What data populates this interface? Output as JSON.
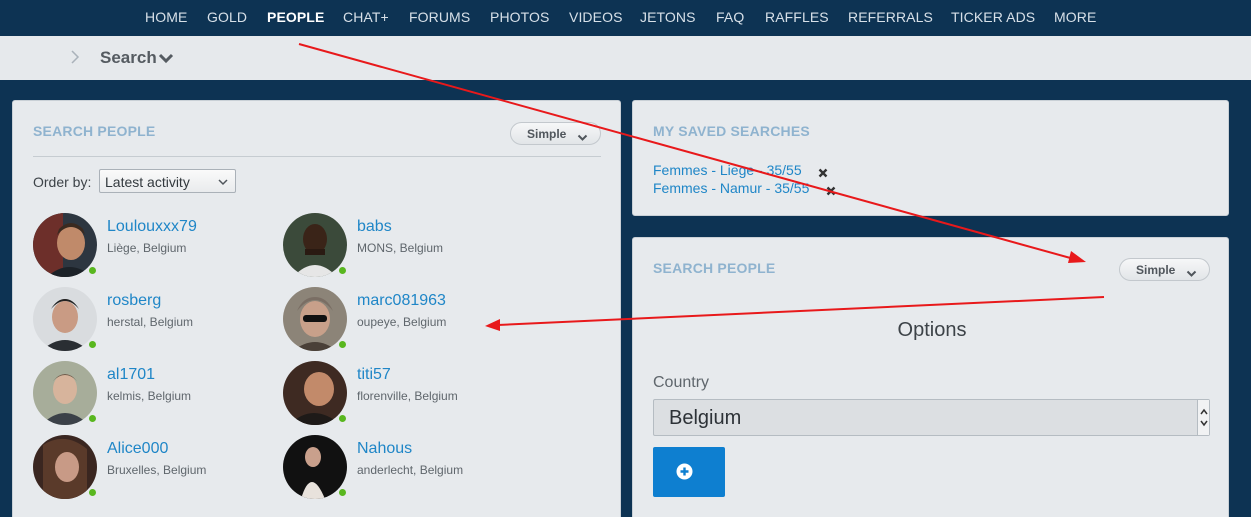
{
  "nav": {
    "items": [
      {
        "label": "HOME"
      },
      {
        "label": "GOLD"
      },
      {
        "label": "PEOPLE",
        "active": true
      },
      {
        "label": "CHAT+"
      },
      {
        "label": "FORUMS"
      },
      {
        "label": "PHOTOS"
      },
      {
        "label": "VIDEOS"
      },
      {
        "label": "JETONS"
      },
      {
        "label": "FAQ"
      },
      {
        "label": "RAFFLES"
      },
      {
        "label": "REFERRALS"
      },
      {
        "label": "TICKER ADS"
      },
      {
        "label": "MORE"
      }
    ]
  },
  "breadcrumb": {
    "label": "Search",
    "icons": {
      "separator": "chevron-right-icon",
      "dropdown": "chevron-down-icon"
    }
  },
  "search_panel": {
    "title": "SEARCH PEOPLE",
    "mode_label": "Simple",
    "order_by_label": "Order by:",
    "order_by_value": "Latest activity",
    "users": [
      {
        "name": "Loulouxxx79",
        "location": "Liège, Belgium",
        "online": true
      },
      {
        "name": "babs",
        "location": "MONS, Belgium",
        "online": true
      },
      {
        "name": "rosberg",
        "location": "herstal, Belgium",
        "online": true
      },
      {
        "name": "marc081963",
        "location": "oupeye, Belgium",
        "online": true
      },
      {
        "name": "al1701",
        "location": "kelmis, Belgium",
        "online": true
      },
      {
        "name": "titi57",
        "location": "florenville, Belgium",
        "online": true
      },
      {
        "name": "Alice000",
        "location": "Bruxelles, Belgium",
        "online": true
      },
      {
        "name": "Nahous",
        "location": "anderlecht, Belgium",
        "online": true
      }
    ]
  },
  "saved_searches": {
    "title": "MY SAVED SEARCHES",
    "items": [
      {
        "label": "Femmes - Liege - 35/55"
      },
      {
        "label": "Femmes - Namur - 35/55"
      }
    ]
  },
  "search_panel_right": {
    "title": "SEARCH PEOPLE",
    "mode_label": "Simple",
    "options_title": "Options",
    "country_label": "Country",
    "country_value": "Belgium",
    "add_icon": "plus-circle-icon"
  },
  "colors": {
    "nav_bg": "#0d3353",
    "panel_bg": "#e7eaed",
    "link": "#1f86c7",
    "panel_title": "#8fb3cf",
    "online": "#59b71f",
    "primary_button": "#0e7fd0",
    "annotation_arrow": "#e8191b"
  }
}
